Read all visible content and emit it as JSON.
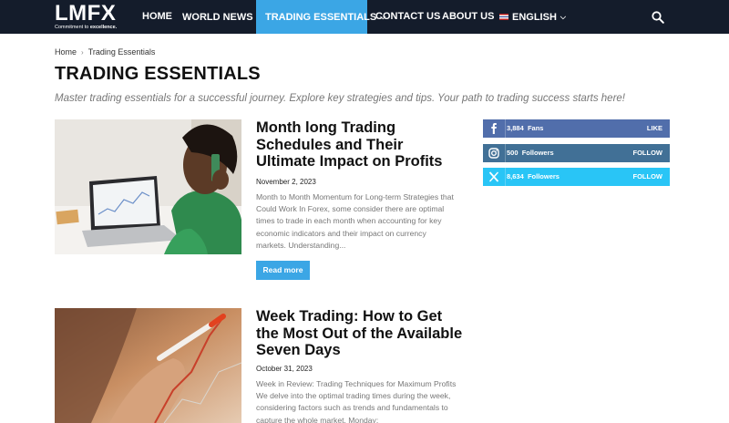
{
  "header": {
    "logo_text": "LMFX",
    "logo_tagline_prefix": "Commitment to ",
    "logo_tagline_bold": "excellence.",
    "nav": [
      {
        "label": "HOME"
      },
      {
        "label": "WORLD NEWS"
      },
      {
        "label": "TRADING ESSENTIALS"
      },
      {
        "label": "CONTACT US"
      },
      {
        "label": "ABOUT US"
      },
      {
        "label": "ENGLISH"
      }
    ],
    "search_icon": "search-icon"
  },
  "breadcrumb": {
    "home": "Home",
    "current": "Trading Essentials"
  },
  "page": {
    "title": "TRADING ESSENTIALS",
    "subtitle": "Master trading essentials for a successful journey. Explore key strategies and tips. Your path to trading success starts here!"
  },
  "articles": [
    {
      "title": "Month long Trading Schedules and Their Ultimate Impact on Profits",
      "date": "November 2, 2023",
      "excerpt": "Month to Month Momentum for Long-term Strategies that Could Work In Forex, some consider there are optimal times to trade in each month when accounting for key economic indicators and their impact on currency markets. Understanding...",
      "read_more": "Read more"
    },
    {
      "title": "Week Trading: How to Get the Most Out of the Available Seven Days",
      "date": "October 31, 2023",
      "excerpt": "Week in Review: Trading Techniques for Maximum Profits We delve into the optimal trading times during the week, considering factors such as trends and fundamentals to capture the whole market. Monday:"
    }
  ],
  "social": [
    {
      "network": "facebook",
      "icon": "facebook-icon",
      "count": "3,884",
      "unit": "Fans",
      "action": "LIKE",
      "color": "#516eab"
    },
    {
      "network": "instagram",
      "icon": "instagram-icon",
      "count": "500",
      "unit": "Followers",
      "action": "FOLLOW",
      "color": "#417096"
    },
    {
      "network": "x",
      "icon": "x-icon",
      "count": "8,634",
      "unit": "Followers",
      "action": "FOLLOW",
      "color": "#29c5f6"
    }
  ],
  "colors": {
    "header_bg": "#141c2b",
    "accent": "#3ba6e5"
  }
}
